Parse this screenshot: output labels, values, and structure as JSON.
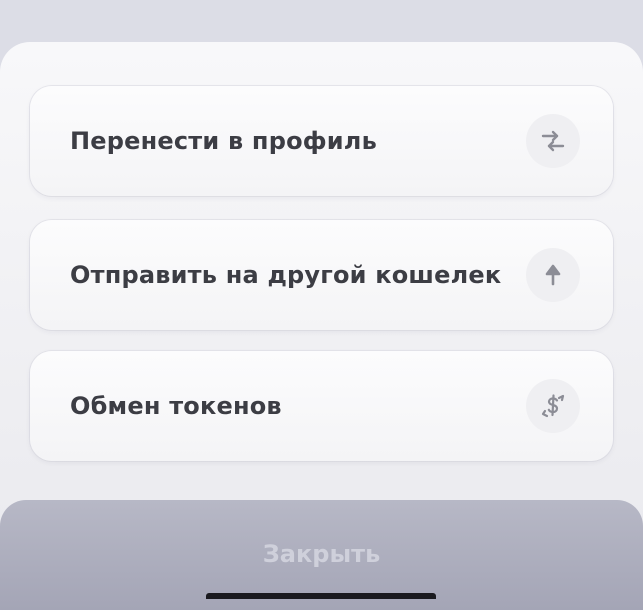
{
  "actions": [
    {
      "label": "Перенести в профиль",
      "icon": "transfer-arrows-icon"
    },
    {
      "label": "Отправить на другой кошелек",
      "icon": "arrow-up-icon"
    },
    {
      "label": "Обмен токенов",
      "icon": "token-swap-icon"
    }
  ],
  "close": {
    "label": "Закрыть"
  },
  "colors": {
    "card_text": "#3c3d44",
    "icon_gray": "#8c8d96",
    "close_button": "#abacbd",
    "close_text": "#cfd0db"
  }
}
